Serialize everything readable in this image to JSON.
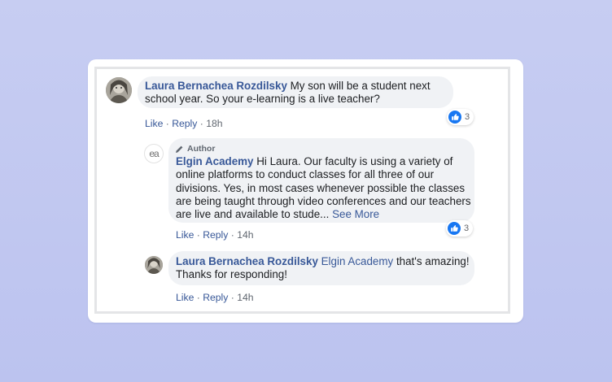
{
  "comments": [
    {
      "author": "Laura Bernachea Rozdilsky",
      "text": "My son will be a student next school year. So your e-learning is a live teacher?",
      "like_label": "Like",
      "reply_label": "Reply",
      "separator": " · ",
      "time": "18h",
      "reaction_count": "3",
      "avatar_icon": "user-photo-avatar"
    },
    {
      "author_badge": "Author",
      "author": "Elgin Academy",
      "text_line1": "Hi Laura. Our faculty is using a variety of",
      "text_line2": "online platforms to conduct classes for all three of our",
      "text_line3": "divisions. Yes, in most cases whenever possible the classes",
      "text_line4": "are being taught through video conferences and our teachers",
      "text_line5": "are live and available to stude...",
      "see_more": "See More",
      "like_label": "Like",
      "reply_label": "Reply",
      "separator": " · ",
      "time": "14h",
      "reaction_count": "3",
      "avatar_icon": "elgin-academy-logo",
      "avatar_text": "ea"
    },
    {
      "author": "Laura Bernachea Rozdilsky",
      "mention": "Elgin Academy",
      "text_line1": "that's amazing!",
      "text_line2": "Thanks for responding!",
      "like_label": "Like",
      "reply_label": "Reply",
      "separator": " · ",
      "time": "14h",
      "avatar_icon": "user-photo-avatar"
    }
  ],
  "colors": {
    "link": "#385898",
    "bubble": "#f0f2f5",
    "like_blue": "#1877f2",
    "background": "#c7cdf2"
  }
}
